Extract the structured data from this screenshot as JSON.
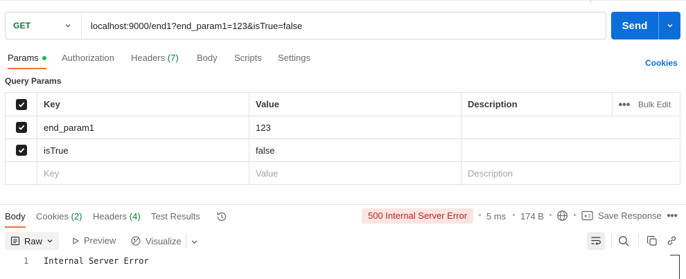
{
  "request": {
    "method": "GET",
    "url": "localhost:9000/end1?end_param1=123&isTrue=false",
    "send_label": "Send"
  },
  "request_tabs": [
    {
      "label": "Params",
      "active": true
    },
    {
      "label": "Authorization"
    },
    {
      "label": "Headers",
      "count": "(7)"
    },
    {
      "label": "Body"
    },
    {
      "label": "Scripts"
    },
    {
      "label": "Settings"
    }
  ],
  "cookies_link": "Cookies",
  "query_params": {
    "title": "Query Params",
    "headers": {
      "key": "Key",
      "value": "Value",
      "description": "Description",
      "bulk_edit": "Bulk Edit"
    },
    "rows": [
      {
        "checked": true,
        "key": "end_param1",
        "value": "123",
        "description": ""
      },
      {
        "checked": true,
        "key": "isTrue",
        "value": "false",
        "description": ""
      }
    ],
    "placeholders": {
      "key": "Key",
      "value": "Value",
      "description": "Description"
    }
  },
  "response_tabs": [
    {
      "label": "Body",
      "active": true
    },
    {
      "label": "Cookies",
      "count": "(2)"
    },
    {
      "label": "Headers",
      "count": "(4)"
    },
    {
      "label": "Test Results"
    }
  ],
  "response": {
    "status": "500 Internal Server Error",
    "time": "5 ms",
    "size": "174 B",
    "save_label": "Save Response",
    "format": "Raw",
    "preview_label": "Preview",
    "visualize_label": "Visualize",
    "lines": [
      {
        "num": "1",
        "text": "Internal Server Error"
      }
    ]
  },
  "colors": {
    "accent": "#0b6ed9",
    "tab_indicator": "#ff6c37",
    "method_get": "#0d7a3e",
    "error_bg": "#fbe5e1",
    "error_text": "#b3261e"
  }
}
